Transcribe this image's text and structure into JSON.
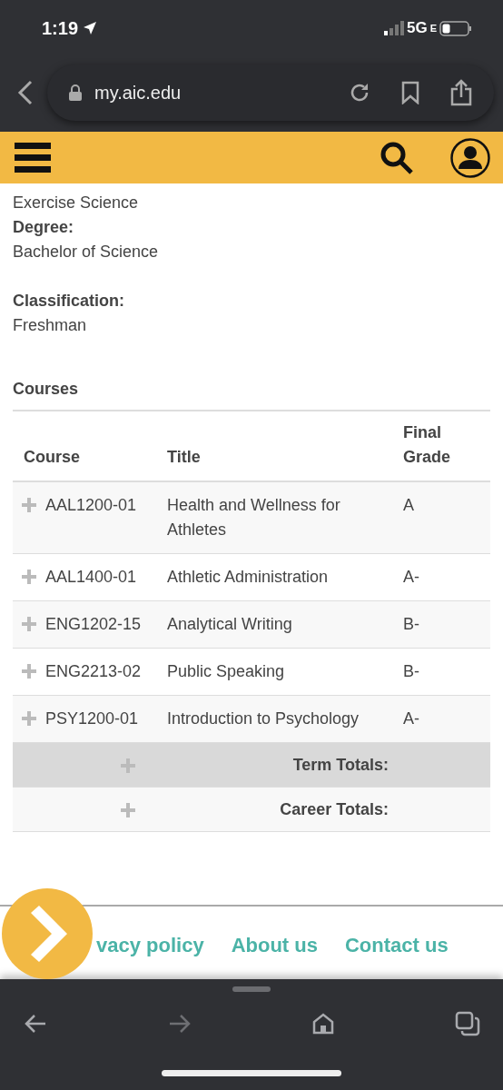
{
  "status_bar": {
    "time": "1:19",
    "network": "5G",
    "network_suffix": "E"
  },
  "browser": {
    "url": "my.aic.edu"
  },
  "profile": {
    "major": "Exercise Science",
    "degree_label": "Degree:",
    "degree": "Bachelor of Science",
    "classification_label": "Classification:",
    "classification": "Freshman"
  },
  "courses": {
    "title": "Courses",
    "columns": [
      "Course",
      "Title",
      "Final Grade"
    ],
    "rows": [
      {
        "course": "AAL1200-01",
        "title": "Health and Wellness for Athletes",
        "grade": "A"
      },
      {
        "course": "AAL1400-01",
        "title": "Athletic Administration",
        "grade": "A-"
      },
      {
        "course": "ENG1202-15",
        "title": "Analytical Writing",
        "grade": "B-"
      },
      {
        "course": "ENG2213-02",
        "title": "Public Speaking",
        "grade": "B-"
      },
      {
        "course": "PSY1200-01",
        "title": "Introduction to Psychology",
        "grade": "A-"
      }
    ],
    "totals": [
      {
        "label": "Term Totals:",
        "kind": "term"
      },
      {
        "label": "Career Totals:",
        "kind": "career"
      }
    ]
  },
  "footer_links": [
    "vacy policy",
    "About us",
    "Contact us"
  ],
  "toolbar": [
    {
      "kind": "back",
      "disabled": false
    },
    {
      "kind": "forward",
      "disabled": true
    },
    {
      "kind": "home",
      "disabled": false
    },
    {
      "kind": "tabs",
      "disabled": false
    }
  ]
}
